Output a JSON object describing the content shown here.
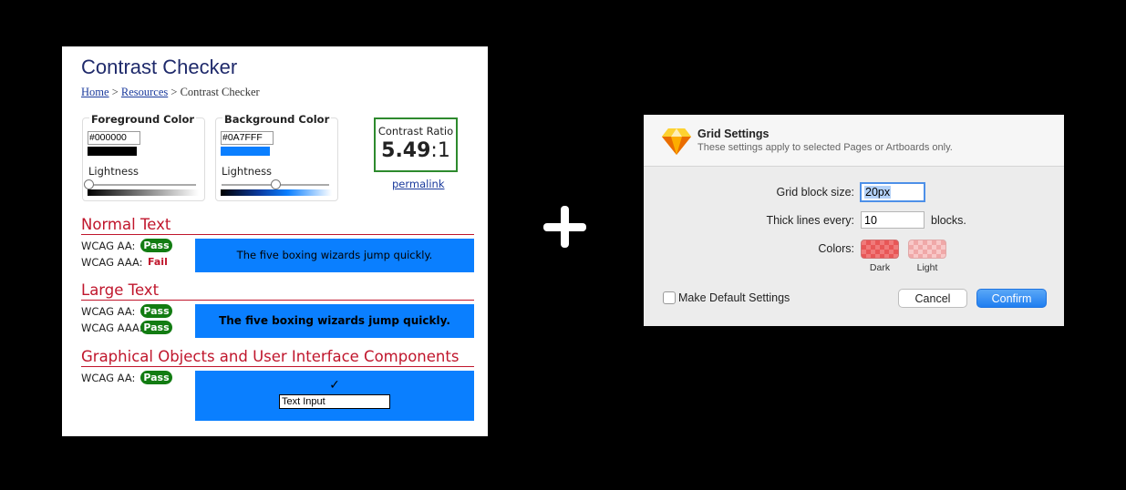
{
  "contrast_checker": {
    "title": "Contrast Checker",
    "breadcrumb": {
      "home": "Home",
      "sep1": ">",
      "resources": "Resources",
      "sep2": ">",
      "current": "Contrast Checker"
    },
    "foreground": {
      "label": "Foreground Color",
      "hex": "#000000",
      "lightness_label": "Lightness",
      "lightness_value": 0,
      "color": "#000000"
    },
    "background": {
      "label": "Background Color",
      "hex": "#0A7FFF",
      "lightness_label": "Lightness",
      "lightness_value": 0.5,
      "color": "#0A7FFF"
    },
    "ratio": {
      "label": "Contrast Ratio",
      "value": "5.49",
      "suffix": ":1"
    },
    "permalink": "permalink",
    "normal_text": {
      "heading": "Normal Text",
      "aa_label": "WCAG AA:",
      "aa_result": "Pass",
      "aaa_label": "WCAG AAA:",
      "aaa_result": "Fail",
      "sample": "The five boxing wizards jump quickly."
    },
    "large_text": {
      "heading": "Large Text",
      "aa_label": "WCAG AA:",
      "aa_result": "Pass",
      "aaa_label": "WCAG AAA:",
      "aaa_result": "Pass",
      "sample": "The five boxing wizards jump quickly."
    },
    "graphical": {
      "heading": "Graphical Objects and User Interface Components",
      "aa_label": "WCAG AA:",
      "aa_result": "Pass",
      "checkmark": "✓",
      "input_text": "Text Input"
    }
  },
  "plus_icon": "plus-icon",
  "grid_settings": {
    "title": "Grid Settings",
    "subtitle": "These settings apply to selected Pages or Artboards only.",
    "block_size_label": "Grid block size:",
    "block_size_value": "20px",
    "thick_lines_label": "Thick lines every:",
    "thick_lines_value": "10",
    "thick_lines_suffix": "blocks.",
    "colors_label": "Colors:",
    "dark_label": "Dark",
    "light_label": "Light",
    "default_checkbox_label": "Make Default Settings",
    "cancel_label": "Cancel",
    "confirm_label": "Confirm"
  }
}
